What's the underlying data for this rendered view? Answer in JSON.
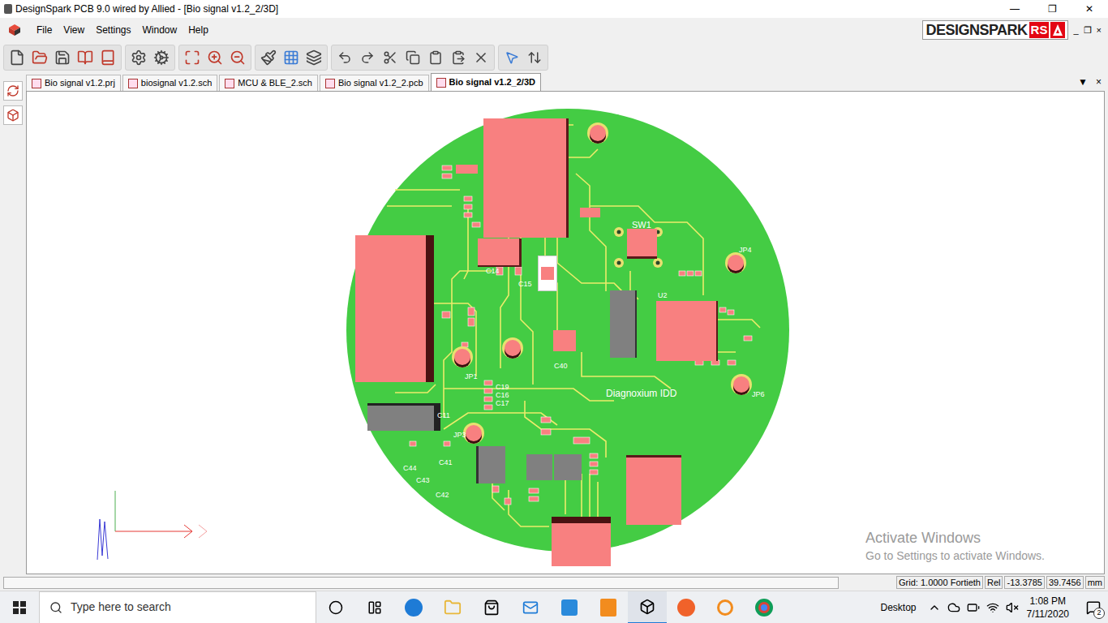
{
  "window": {
    "title": "DesignSpark PCB 9.0 wired by Allied - [Bio signal v1.2_2/3D]",
    "controls": [
      "—",
      "❐",
      "✕"
    ]
  },
  "menu": [
    "File",
    "View",
    "Settings",
    "Window",
    "Help"
  ],
  "logo": {
    "text": "DESIGNSPARK",
    "badge": "RS"
  },
  "mdi_controls": [
    "_",
    "❐",
    "×"
  ],
  "tabs": [
    {
      "label": "Bio signal v1.2.prj",
      "selected": false
    },
    {
      "label": "biosignal v1.2.sch",
      "selected": false
    },
    {
      "label": "MCU & BLE_2.sch",
      "selected": false
    },
    {
      "label": "Bio signal v1.2_2.pcb",
      "selected": false
    },
    {
      "label": "Bio signal v1.2_2/3D",
      "selected": true
    }
  ],
  "tab_controls": [
    "▼",
    "×"
  ],
  "board": {
    "title": "Diagnoxium IDD",
    "labels": [
      "SW1",
      "C14",
      "C15",
      "C40",
      "C19",
      "C16",
      "C17",
      "C11",
      "C41",
      "C44",
      "C43",
      "C42",
      "JP1",
      "JP3",
      "U2",
      "JP6",
      "JP4"
    ]
  },
  "watermark": {
    "title": "Activate Windows",
    "subtitle": "Go to Settings to activate Windows."
  },
  "status_bar": {
    "grid": "Grid: 1.0000 Fortieth",
    "mode": "Rel",
    "x": "-13.3785",
    "y": "39.7456",
    "unit": "mm"
  },
  "taskbar": {
    "search": "Type here to search",
    "desktop": "Desktop",
    "time": "1:08 PM",
    "date": "7/11/2020",
    "notifications": "2"
  }
}
